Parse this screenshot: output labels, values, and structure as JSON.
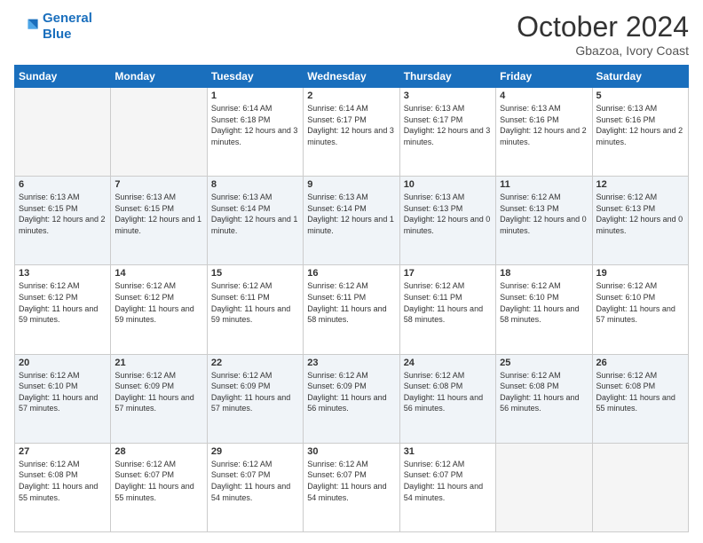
{
  "logo": {
    "line1": "General",
    "line2": "Blue"
  },
  "title": "October 2024",
  "subtitle": "Gbazoa, Ivory Coast",
  "days_of_week": [
    "Sunday",
    "Monday",
    "Tuesday",
    "Wednesday",
    "Thursday",
    "Friday",
    "Saturday"
  ],
  "weeks": [
    [
      {
        "day": "",
        "empty": true
      },
      {
        "day": "",
        "empty": true
      },
      {
        "day": "1",
        "sunrise": "6:14 AM",
        "sunset": "6:18 PM",
        "daylight": "12 hours and 3 minutes."
      },
      {
        "day": "2",
        "sunrise": "6:14 AM",
        "sunset": "6:17 PM",
        "daylight": "12 hours and 3 minutes."
      },
      {
        "day": "3",
        "sunrise": "6:13 AM",
        "sunset": "6:17 PM",
        "daylight": "12 hours and 3 minutes."
      },
      {
        "day": "4",
        "sunrise": "6:13 AM",
        "sunset": "6:16 PM",
        "daylight": "12 hours and 2 minutes."
      },
      {
        "day": "5",
        "sunrise": "6:13 AM",
        "sunset": "6:16 PM",
        "daylight": "12 hours and 2 minutes."
      }
    ],
    [
      {
        "day": "6",
        "sunrise": "6:13 AM",
        "sunset": "6:15 PM",
        "daylight": "12 hours and 2 minutes."
      },
      {
        "day": "7",
        "sunrise": "6:13 AM",
        "sunset": "6:15 PM",
        "daylight": "12 hours and 1 minute."
      },
      {
        "day": "8",
        "sunrise": "6:13 AM",
        "sunset": "6:14 PM",
        "daylight": "12 hours and 1 minute."
      },
      {
        "day": "9",
        "sunrise": "6:13 AM",
        "sunset": "6:14 PM",
        "daylight": "12 hours and 1 minute."
      },
      {
        "day": "10",
        "sunrise": "6:13 AM",
        "sunset": "6:13 PM",
        "daylight": "12 hours and 0 minutes."
      },
      {
        "day": "11",
        "sunrise": "6:12 AM",
        "sunset": "6:13 PM",
        "daylight": "12 hours and 0 minutes."
      },
      {
        "day": "12",
        "sunrise": "6:12 AM",
        "sunset": "6:13 PM",
        "daylight": "12 hours and 0 minutes."
      }
    ],
    [
      {
        "day": "13",
        "sunrise": "6:12 AM",
        "sunset": "6:12 PM",
        "daylight": "11 hours and 59 minutes."
      },
      {
        "day": "14",
        "sunrise": "6:12 AM",
        "sunset": "6:12 PM",
        "daylight": "11 hours and 59 minutes."
      },
      {
        "day": "15",
        "sunrise": "6:12 AM",
        "sunset": "6:11 PM",
        "daylight": "11 hours and 59 minutes."
      },
      {
        "day": "16",
        "sunrise": "6:12 AM",
        "sunset": "6:11 PM",
        "daylight": "11 hours and 58 minutes."
      },
      {
        "day": "17",
        "sunrise": "6:12 AM",
        "sunset": "6:11 PM",
        "daylight": "11 hours and 58 minutes."
      },
      {
        "day": "18",
        "sunrise": "6:12 AM",
        "sunset": "6:10 PM",
        "daylight": "11 hours and 58 minutes."
      },
      {
        "day": "19",
        "sunrise": "6:12 AM",
        "sunset": "6:10 PM",
        "daylight": "11 hours and 57 minutes."
      }
    ],
    [
      {
        "day": "20",
        "sunrise": "6:12 AM",
        "sunset": "6:10 PM",
        "daylight": "11 hours and 57 minutes."
      },
      {
        "day": "21",
        "sunrise": "6:12 AM",
        "sunset": "6:09 PM",
        "daylight": "11 hours and 57 minutes."
      },
      {
        "day": "22",
        "sunrise": "6:12 AM",
        "sunset": "6:09 PM",
        "daylight": "11 hours and 57 minutes."
      },
      {
        "day": "23",
        "sunrise": "6:12 AM",
        "sunset": "6:09 PM",
        "daylight": "11 hours and 56 minutes."
      },
      {
        "day": "24",
        "sunrise": "6:12 AM",
        "sunset": "6:08 PM",
        "daylight": "11 hours and 56 minutes."
      },
      {
        "day": "25",
        "sunrise": "6:12 AM",
        "sunset": "6:08 PM",
        "daylight": "11 hours and 56 minutes."
      },
      {
        "day": "26",
        "sunrise": "6:12 AM",
        "sunset": "6:08 PM",
        "daylight": "11 hours and 55 minutes."
      }
    ],
    [
      {
        "day": "27",
        "sunrise": "6:12 AM",
        "sunset": "6:08 PM",
        "daylight": "11 hours and 55 minutes."
      },
      {
        "day": "28",
        "sunrise": "6:12 AM",
        "sunset": "6:07 PM",
        "daylight": "11 hours and 55 minutes."
      },
      {
        "day": "29",
        "sunrise": "6:12 AM",
        "sunset": "6:07 PM",
        "daylight": "11 hours and 54 minutes."
      },
      {
        "day": "30",
        "sunrise": "6:12 AM",
        "sunset": "6:07 PM",
        "daylight": "11 hours and 54 minutes."
      },
      {
        "day": "31",
        "sunrise": "6:12 AM",
        "sunset": "6:07 PM",
        "daylight": "11 hours and 54 minutes."
      },
      {
        "day": "",
        "empty": true
      },
      {
        "day": "",
        "empty": true
      }
    ]
  ]
}
